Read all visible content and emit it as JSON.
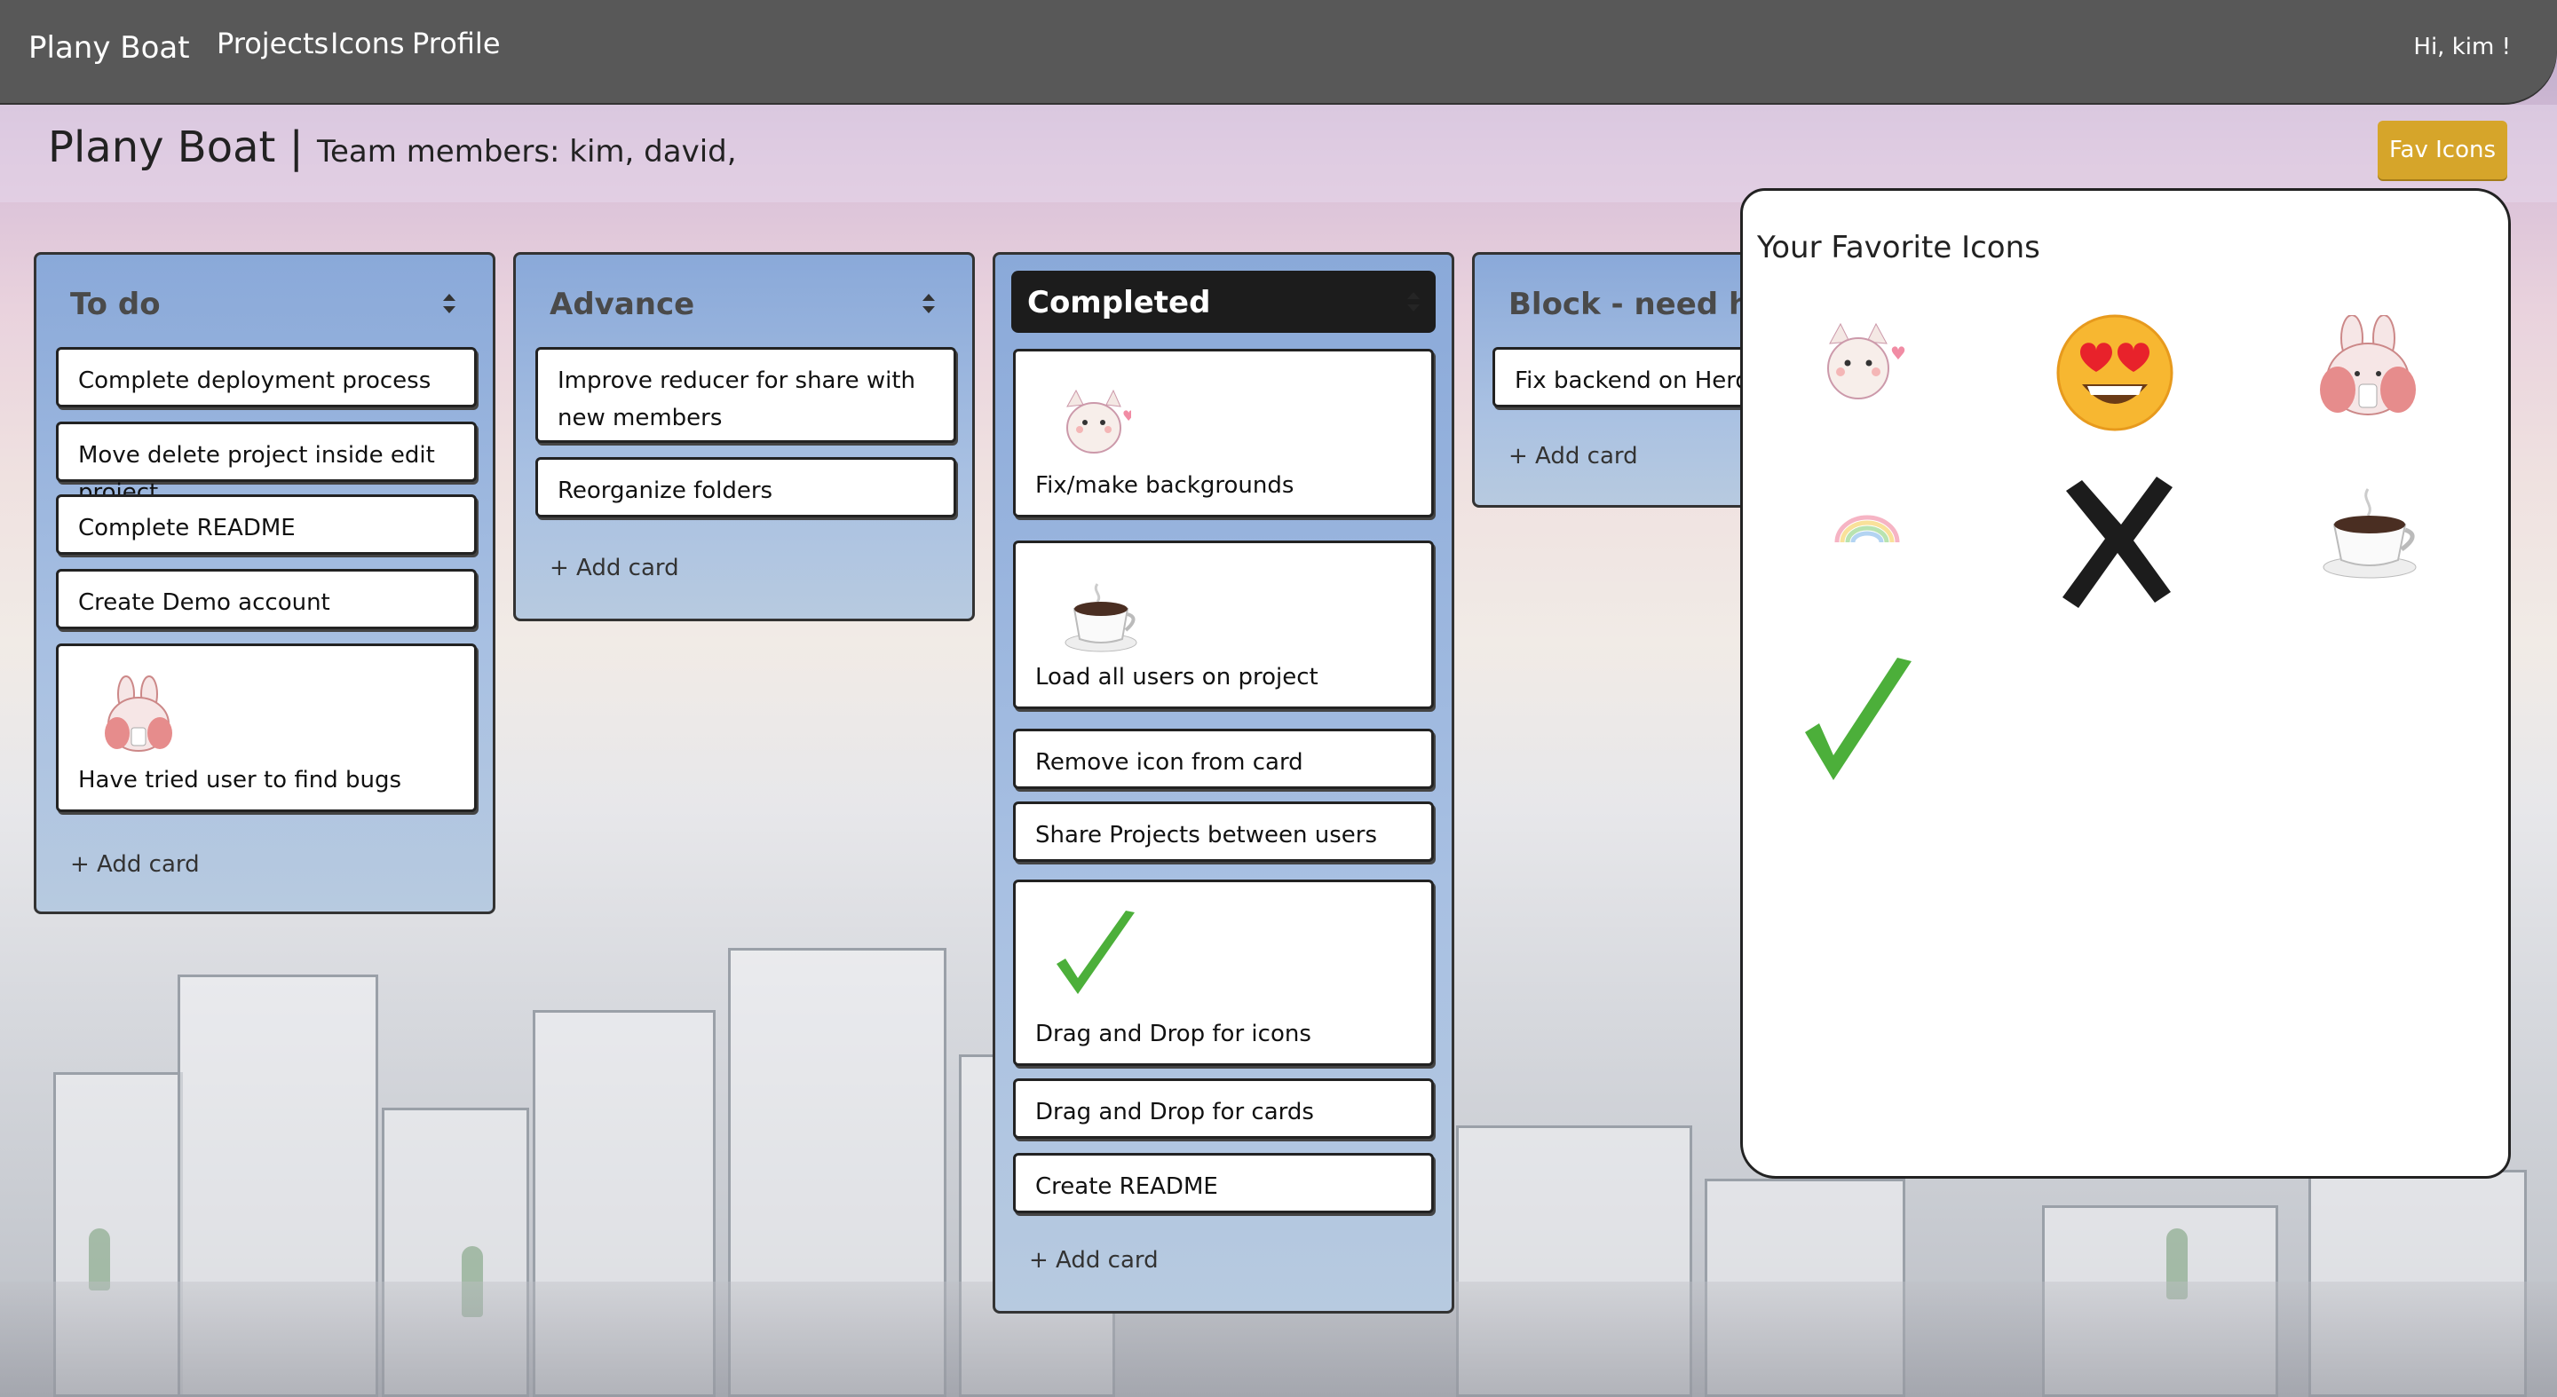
{
  "navbar": {
    "brand": "Plany Boat",
    "links": [
      "Projects",
      "Icons",
      "Profile"
    ],
    "greeting": "Hi, kim !"
  },
  "header": {
    "title": "Plany Boat |",
    "team": "Team members: kim, david,",
    "fav_button": "Fav Icons"
  },
  "lists": {
    "todo": {
      "title": "To do",
      "cards": [
        "Complete deployment process",
        "Move delete project inside edit project",
        "Complete README",
        "Create Demo account",
        "Have tried user to find bugs"
      ],
      "add": "+ Add card"
    },
    "advance": {
      "title": "Advance",
      "cards": [
        "Improve reducer for share with new members",
        "Reorganize folders"
      ],
      "add": "+ Add card"
    },
    "completed": {
      "title": "Completed",
      "cards": [
        "Fix/make backgrounds",
        "Load all users on project",
        "Remove icon from card",
        "Share Projects between users",
        "Drag and Drop for icons",
        "Drag and Drop for cards",
        "Create README"
      ],
      "add": "+ Add card"
    },
    "block": {
      "title": "Block - need he",
      "cards": [
        "Fix backend on Heroku"
      ],
      "add": "+ Add card"
    }
  },
  "fav_panel": {
    "title": "Your Favorite Icons",
    "icons": [
      "cat-icon",
      "heart-eyes-emoji-icon",
      "bunny-icon",
      "rainbow-icon",
      "x-mark-icon",
      "coffee-icon",
      "checkmark-icon"
    ]
  },
  "colors": {
    "navbar": "#585858",
    "fav_button": "#d6a52a",
    "list_blue": "#8aa9d9",
    "checkmark_green": "#4caf3a"
  }
}
